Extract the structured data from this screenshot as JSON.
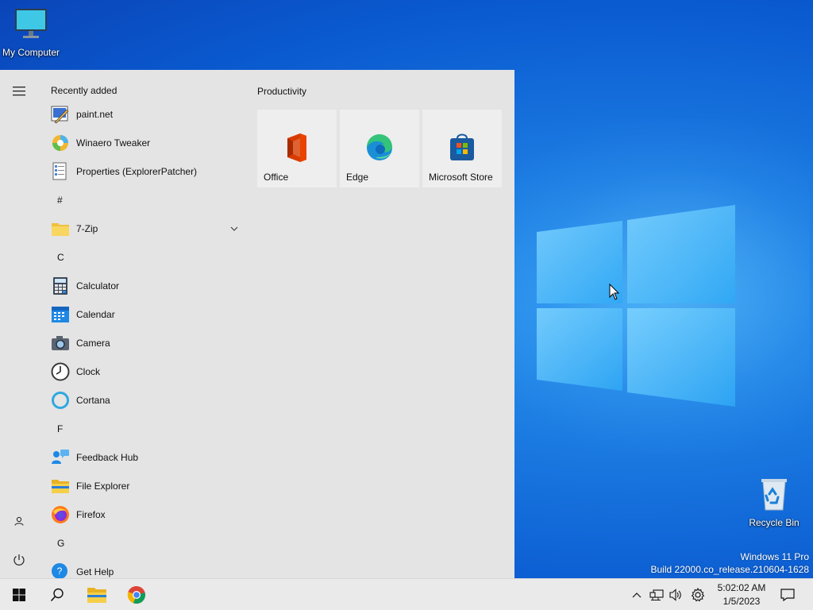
{
  "desktop": {
    "icons": [
      {
        "label": "My Computer",
        "icon": "monitor-icon"
      },
      {
        "label": "Recycle Bin",
        "icon": "recycle-bin-icon"
      }
    ],
    "watermark": {
      "edition": "Windows 11 Pro",
      "build": "Build 22000.co_release.210604-1628"
    }
  },
  "start_menu": {
    "recently_added_heading": "Recently added",
    "recent_apps": [
      {
        "label": "paint.net",
        "icon": "paintnet-icon"
      },
      {
        "label": "Winaero Tweaker",
        "icon": "winaero-tweaker-icon"
      },
      {
        "label": "Properties (ExplorerPatcher)",
        "icon": "properties-icon"
      }
    ],
    "groups": [
      {
        "letter": "#",
        "apps": [
          {
            "label": "7-Zip",
            "icon": "folder-icon",
            "expandable": true
          }
        ]
      },
      {
        "letter": "C",
        "apps": [
          {
            "label": "Calculator",
            "icon": "calculator-icon"
          },
          {
            "label": "Calendar",
            "icon": "calendar-icon"
          },
          {
            "label": "Camera",
            "icon": "camera-icon"
          },
          {
            "label": "Clock",
            "icon": "clock-icon"
          },
          {
            "label": "Cortana",
            "icon": "cortana-icon"
          }
        ]
      },
      {
        "letter": "F",
        "apps": [
          {
            "label": "Feedback Hub",
            "icon": "feedback-hub-icon"
          },
          {
            "label": "File Explorer",
            "icon": "file-explorer-icon"
          },
          {
            "label": "Firefox",
            "icon": "firefox-icon"
          }
        ]
      },
      {
        "letter": "G",
        "apps": [
          {
            "label": "Get Help",
            "icon": "get-help-icon"
          }
        ]
      }
    ],
    "tiles_heading": "Productivity",
    "tiles": [
      {
        "label": "Office",
        "icon": "office-icon"
      },
      {
        "label": "Edge",
        "icon": "edge-icon"
      },
      {
        "label": "Microsoft Store",
        "icon": "store-icon"
      }
    ]
  },
  "taskbar": {
    "time": "5:02:02 AM",
    "date": "1/5/2023"
  }
}
